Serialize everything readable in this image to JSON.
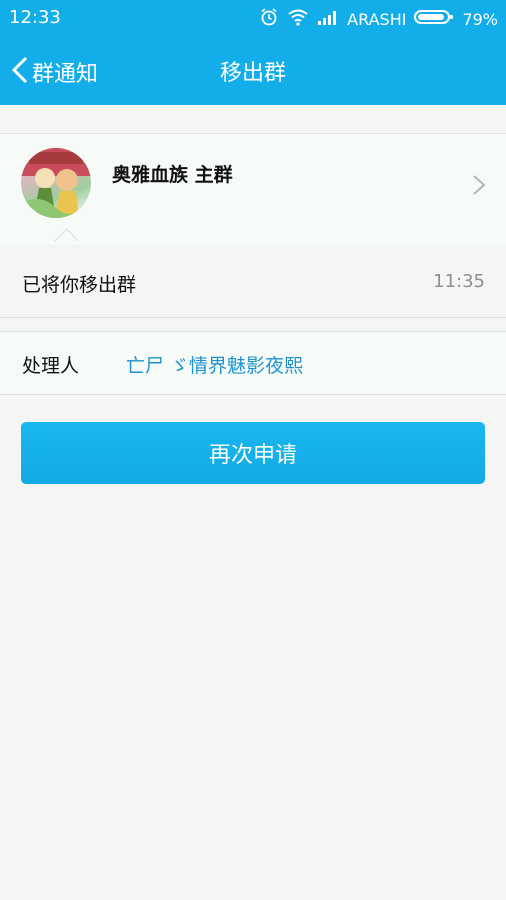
{
  "status_bar": {
    "time": "12:33",
    "carrier": "ARASHI",
    "battery": "79%",
    "icons": [
      "alarm-icon",
      "wifi-icon",
      "signal-icon",
      "battery-icon"
    ]
  },
  "header": {
    "back_label": "群通知",
    "title": "移出群"
  },
  "group": {
    "name": "奥雅血族 主群",
    "avatar": "group-avatar"
  },
  "notice": {
    "message": "已将你移出群",
    "time": "11:35"
  },
  "handler": {
    "label": "处理人",
    "name": "亡尸 ゞ情界魅影夜熙"
  },
  "action": {
    "reapply_label": "再次申请"
  },
  "colors": {
    "accent": "#13aeea",
    "link": "#1f93d0",
    "background": "#f5f5f5"
  }
}
